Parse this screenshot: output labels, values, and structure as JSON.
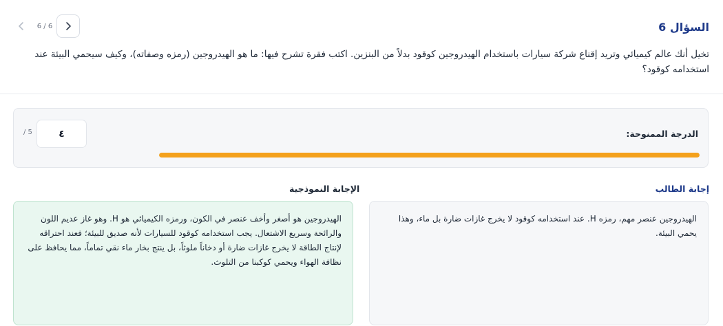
{
  "question": {
    "title": "السؤال 6",
    "text": "تخيل أنك عالم كيميائي وتريد إقناع شركة سيارات باستخدام الهيدروجين كوقود بدلاً من البنزين. اكتب فقرة تشرح فيها: ما هو الهيدروجين (رمزه وصفاته)، وكيف سيحمي البيئة عند استخدامه كوقود؟"
  },
  "navigation": {
    "counter": "6 / 6",
    "prev_icon": "chevron-left-icon",
    "next_icon": "chevron-right-icon"
  },
  "score": {
    "label": "الدرجة الممنوحة:",
    "value": "٤",
    "max": "/ 5",
    "progress_fraction": 1.0,
    "bar_color": "#f4a11c"
  },
  "student_answer": {
    "label": "إجابة الطالب",
    "text": "الهيدروجين عنصر مهم، رمزه H. عند استخدامه كوقود لا يخرج غازات ضارة بل ماء، وهذا يحمي البيئة."
  },
  "model_answer": {
    "label": "الإجابة النموذجية",
    "text": "الهيدروجين هو أصغر وأخف عنصر في الكون، ورمزه الكيميائي هو H. وهو غاز عديم اللون والرائحة وسريع الاشتعال. يجب استخدامه كوقود للسيارات لأنه صديق للبيئة؛ فعند احتراقه لإنتاج الطاقة لا يخرج غازات ضارة أو دخاناً ملوثاً، بل ينتج بخار ماء نقي تماماً، مما يحافظ على نظافة الهواء ويحمي كوكبنا من التلوث."
  },
  "colors": {
    "accent": "#1e3a8a",
    "progress": "#f4a11c",
    "model_bg": "#e9f7f0"
  }
}
